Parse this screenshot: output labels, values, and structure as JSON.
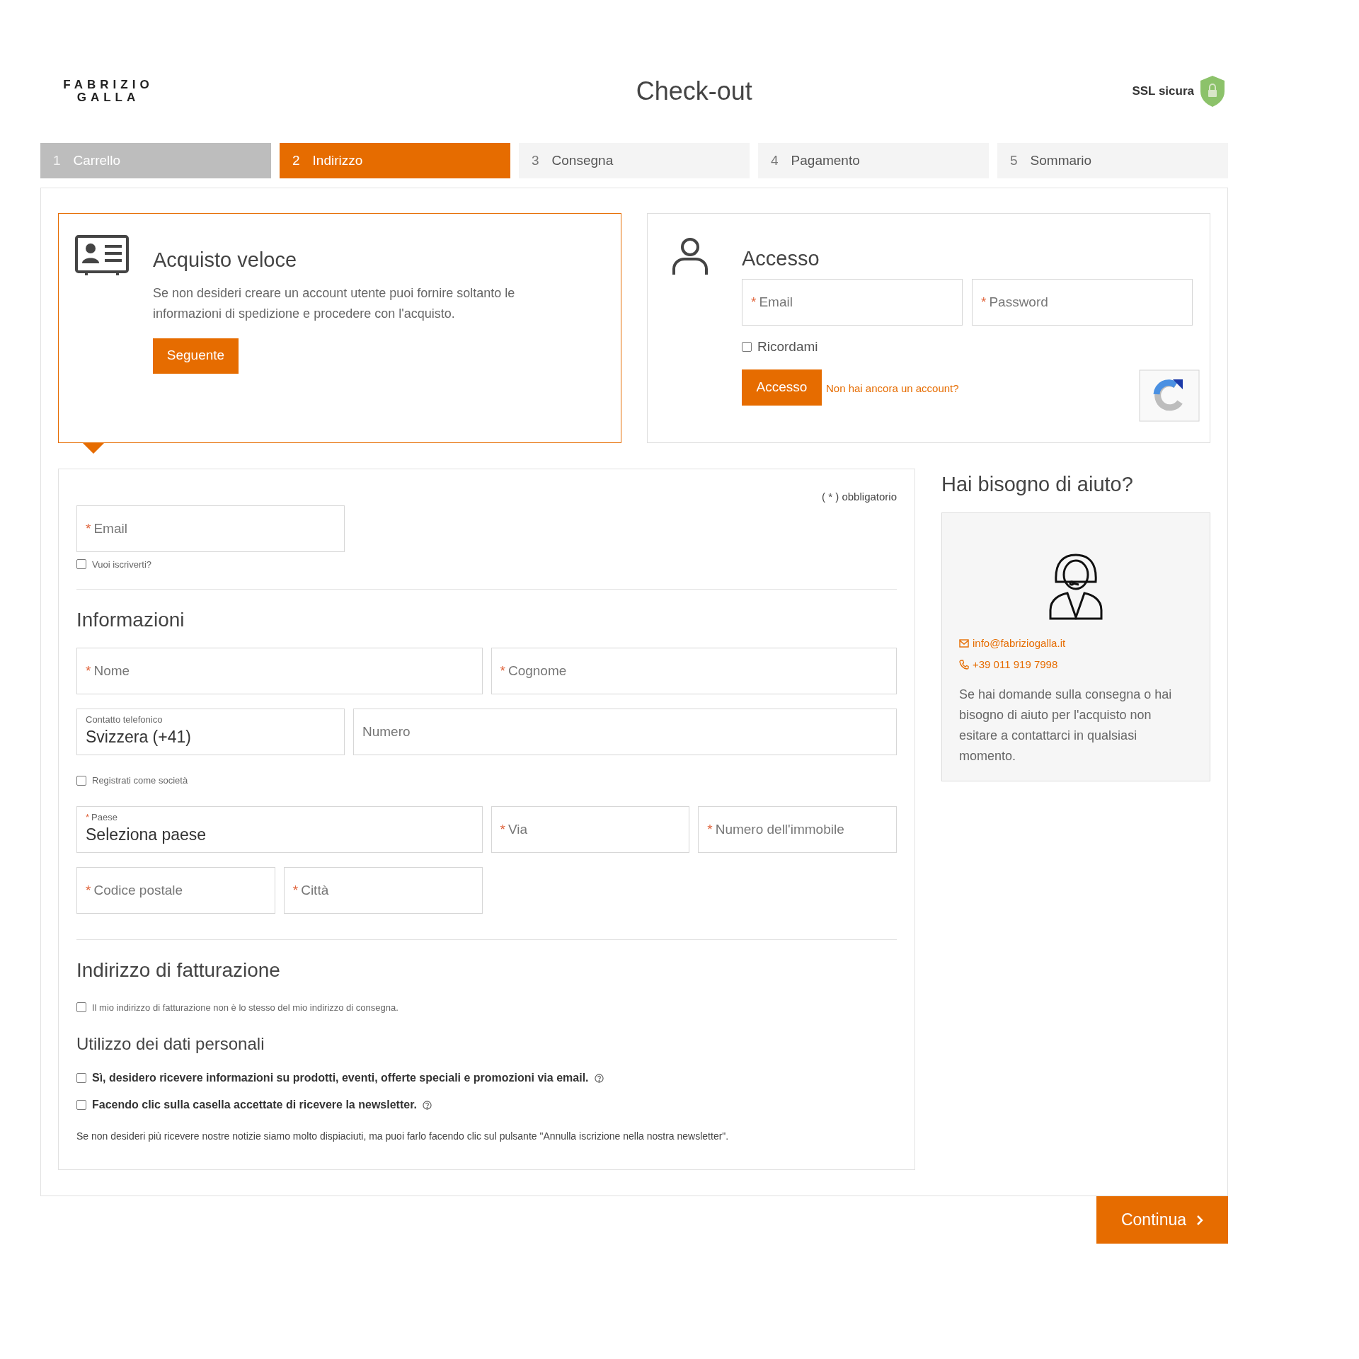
{
  "header": {
    "logo": [
      "FABRIZIO",
      "GALLA"
    ],
    "title": "Check-out",
    "ssl_label": "SSL sicura"
  },
  "steps": [
    {
      "number": "1",
      "label": "Carrello",
      "completed": true,
      "selected": false
    },
    {
      "number": "2",
      "label": "Indirizzo",
      "completed": false,
      "selected": true
    },
    {
      "number": "3",
      "label": "Consegna",
      "completed": false,
      "selected": false
    },
    {
      "number": "4",
      "label": "Pagamento",
      "completed": false,
      "selected": false
    },
    {
      "number": "5",
      "label": "Sommario",
      "completed": false,
      "selected": false
    }
  ],
  "quick_purchase": {
    "selected": true,
    "title": "Acquisto veloce",
    "text": "Se non desideri creare un account utente puoi fornire soltanto le informazioni di spedizione e procedere con l'acquisto.",
    "button": "Seguente"
  },
  "login": {
    "selected": false,
    "title": "Accesso",
    "fields": [
      {
        "mark": "*",
        "placeholder": "Email"
      },
      {
        "mark": "*",
        "placeholder": "Password"
      }
    ],
    "remember": {
      "label": "Ricordami",
      "checked": false
    },
    "button": "Accesso",
    "link": "Non hai ancora un account?"
  },
  "form": {
    "required_note": "( * ) obbligatorio",
    "email": {
      "mark": "*",
      "placeholder": "Email"
    },
    "subscribe": {
      "label": "Vuoi iscriverti?",
      "checked": false
    },
    "info": {
      "title": "Informazioni",
      "name_row": [
        {
          "mark": "*",
          "placeholder": "Nome"
        },
        {
          "mark": "*",
          "placeholder": "Cognome"
        }
      ],
      "phone": {
        "label": "Contatto telefonico",
        "value": "Svizzera (+41)"
      },
      "number": {
        "placeholder": "Numero"
      },
      "company": {
        "label": "Registrati come società",
        "checked": false
      },
      "address_rows": [
        [
          {
            "mark": "*",
            "label": "Paese",
            "value": "Seleziona paese"
          },
          {
            "mark": "*",
            "placeholder": "Via"
          },
          {
            "mark": "*",
            "placeholder": "Numero dell'immobile"
          }
        ],
        [
          {
            "mark": "*",
            "placeholder": "Codice postale"
          },
          {
            "mark": "*",
            "placeholder": "Città"
          }
        ]
      ]
    },
    "billing": {
      "title": "Indirizzo di fatturazione",
      "different": {
        "label": "Il mio indirizzo di fatturazione non è lo stesso del mio indirizzo di consegna.",
        "checked": false
      }
    },
    "privacy": {
      "title": "Utilizzo dei dati personali",
      "consents": [
        {
          "label": "Sì, desidero ricevere informazioni su prodotti, eventi, offerte speciali e promozioni via email.",
          "checked": false
        },
        {
          "label": "Facendo clic sulla casella accettate di ricevere la newsletter.",
          "checked": false
        }
      ],
      "note": "Se non desideri più ricevere nostre notizie siamo molto dispiaciuti, ma puoi farlo facendo clic sul pulsante \"Annulla iscrizione nella nostra newsletter\"."
    }
  },
  "help": {
    "title": "Hai bisogno di aiuto?",
    "email": "info@fabriziogalla.it",
    "phone": "+39 011 919 7998",
    "text": "Se hai domande sulla consegna o hai bisogno di aiuto per l'acquisto non esitare a contattarci in qualsiasi momento."
  },
  "continue_button": "Continua"
}
